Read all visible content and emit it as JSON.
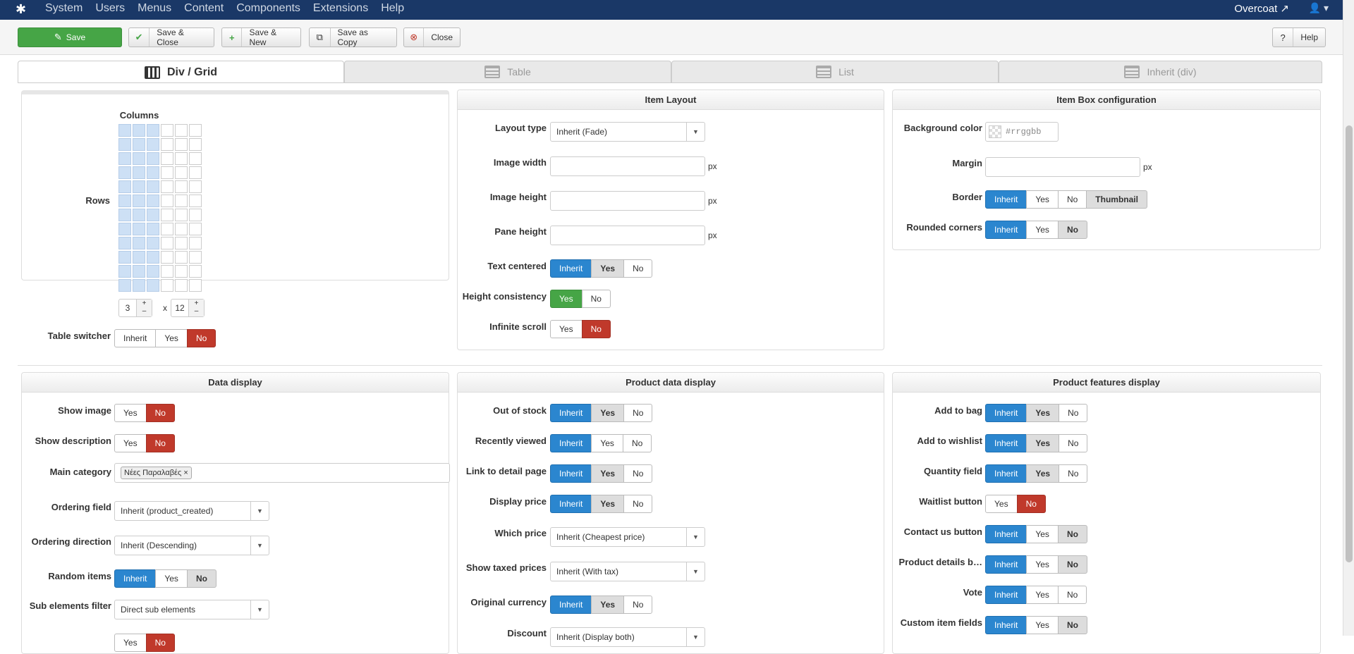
{
  "topbar": {
    "logo_icon": "joomla-icon",
    "menu": [
      "System",
      "Users",
      "Menus",
      "Content",
      "Components",
      "Extensions",
      "Help"
    ],
    "site": "Overcoat",
    "site_icon": "external-link-icon",
    "user_icon": "user-icon"
  },
  "toolbar": {
    "save": "Save",
    "save_close": "Save & Close",
    "save_new": "Save & New",
    "save_copy": "Save as Copy",
    "close": "Close",
    "help": "Help"
  },
  "tabs": [
    "Div / Grid",
    "Table",
    "List",
    "Inherit (div)"
  ],
  "grid_panel": {
    "columns_label": "Columns",
    "rows_label": "Rows",
    "cols_value": "3",
    "rows_value": "12",
    "x": "x",
    "table_switcher_label": "Table switcher",
    "table_switcher": [
      "Inherit",
      "Yes",
      "No"
    ],
    "table_switcher_selected": "No",
    "plus": "+",
    "minus": "–"
  },
  "item_layout": {
    "title": "Item Layout",
    "layout_type_label": "Layout type",
    "layout_type": "Inherit (Fade)",
    "image_width_label": "Image width",
    "image_height_label": "Image height",
    "pane_height_label": "Pane height",
    "px": "px",
    "text_centered_label": "Text centered",
    "height_consistency_label": "Height consistency",
    "infinite_scroll_label": "Infinite scroll",
    "inherit": "Inherit",
    "yes": "Yes",
    "no": "No"
  },
  "item_box": {
    "title": "Item Box configuration",
    "bg_label": "Background color",
    "bg_placeholder": "#rrggbb",
    "margin_label": "Margin",
    "px": "px",
    "border_label": "Border",
    "border_opts": [
      "Inherit",
      "Yes",
      "No",
      "Thumbnail"
    ],
    "rounded_label": "Rounded corners"
  },
  "data_display": {
    "title": "Data display",
    "show_image_label": "Show image",
    "show_desc_label": "Show description",
    "main_category_label": "Main category",
    "main_category_tag": "Νέες Παραλαβές",
    "ordering_field_label": "Ordering field",
    "ordering_field": "Inherit (product_created)",
    "ordering_dir_label": "Ordering direction",
    "ordering_dir": "Inherit (Descending)",
    "random_label": "Random items",
    "sub_filter_label": "Sub elements filter",
    "sub_filter": "Direct sub elements"
  },
  "product_data": {
    "title": "Product data display",
    "out_of_stock_label": "Out of stock",
    "recently_viewed_label": "Recently viewed",
    "link_detail_label": "Link to detail page",
    "display_price_label": "Display price",
    "which_price_label": "Which price",
    "which_price": "Inherit (Cheapest price)",
    "taxed_label": "Show taxed prices",
    "taxed": "Inherit (With tax)",
    "orig_currency_label": "Original currency",
    "discount_label": "Discount",
    "discount": "Inherit (Display both)"
  },
  "product_features": {
    "title": "Product features display",
    "add_bag_label": "Add to bag",
    "add_wishlist_label": "Add to wishlist",
    "quantity_label": "Quantity field",
    "waitlist_label": "Waitlist button",
    "contact_label": "Contact us button",
    "details_label": "Product details b…",
    "vote_label": "Vote",
    "custom_label": "Custom item fields"
  },
  "accent_blue": "#2b86cf",
  "accent_red": "#c0392b",
  "accent_green": "#46a546"
}
